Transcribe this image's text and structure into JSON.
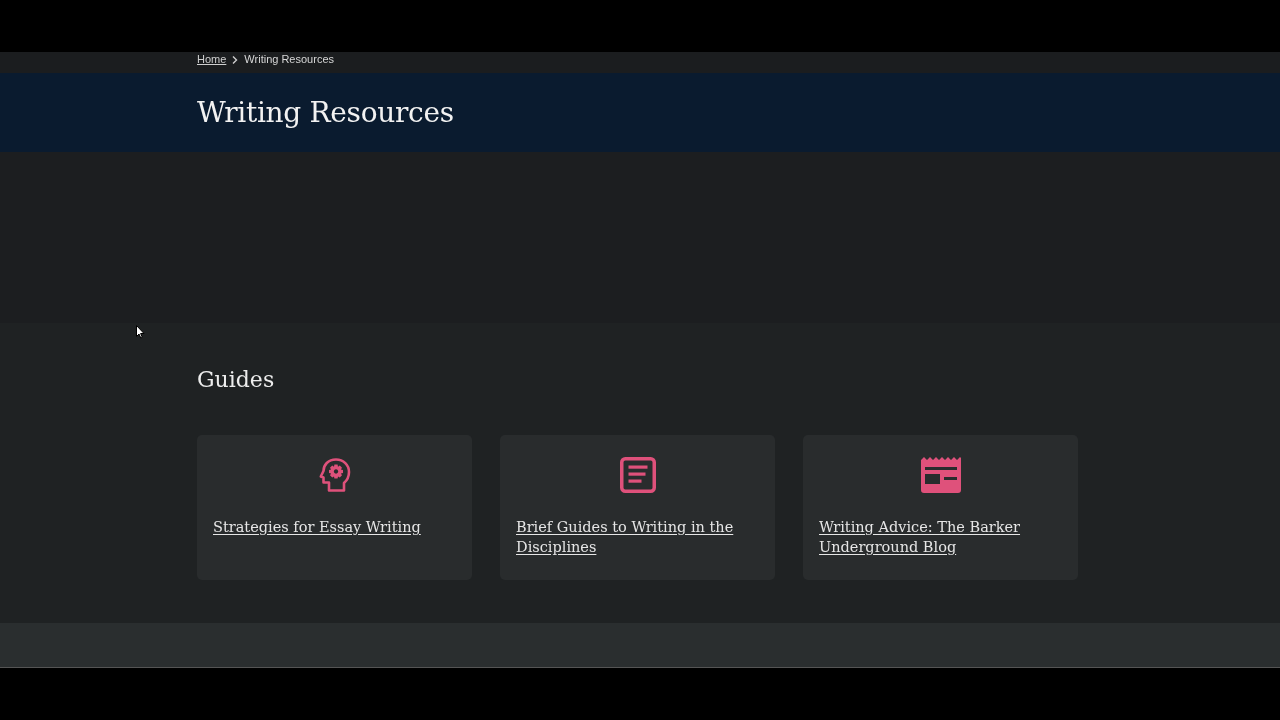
{
  "breadcrumb": [
    {
      "label": "Home",
      "current": false
    },
    {
      "label": "Writing Resources",
      "current": true
    }
  ],
  "page_title": "Writing Resources",
  "guides": {
    "heading": "Guides",
    "cards": [
      {
        "kind": "head-gear",
        "title": "Strategies for Essay Writing"
      },
      {
        "kind": "document",
        "title": "Brief Guides to Writing in the Disciplines"
      },
      {
        "kind": "newspaper",
        "title": "Writing Advice: The Barker Underground Blog"
      }
    ]
  }
}
